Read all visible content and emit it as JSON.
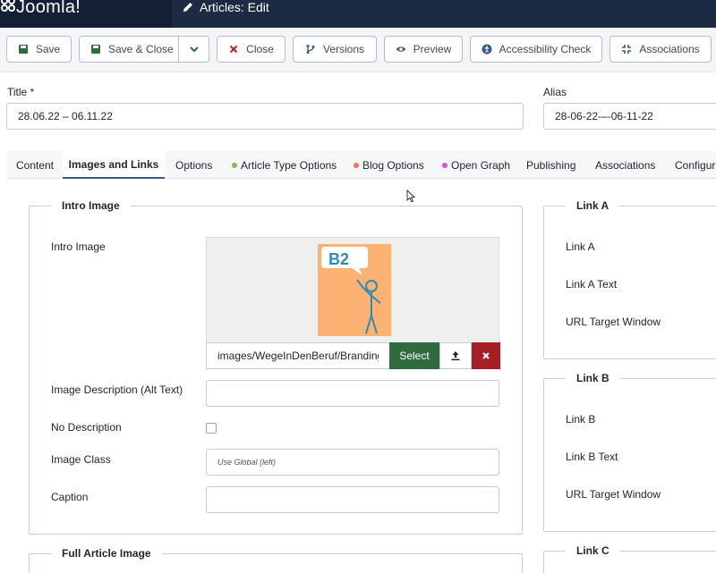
{
  "header": {
    "brand": "Joomla!",
    "page_title": "Articles: Edit"
  },
  "toolbar": {
    "save": "Save",
    "save_close": "Save & Close",
    "close": "Close",
    "versions": "Versions",
    "preview": "Preview",
    "accessibility": "Accessibility Check",
    "associations": "Associations"
  },
  "form": {
    "title_label": "Title *",
    "title_value": "28.06.22 – 06.11.22",
    "alias_label": "Alias",
    "alias_value": "28-06-22-–-06-11-22"
  },
  "tabs": [
    {
      "label": "Content"
    },
    {
      "label": "Images and Links"
    },
    {
      "label": "Options"
    },
    {
      "label": "Article Type Options"
    },
    {
      "label": "Blog Options"
    },
    {
      "label": "Open Graph"
    },
    {
      "label": "Publishing"
    },
    {
      "label": "Associations"
    },
    {
      "label": "Configure"
    }
  ],
  "intro": {
    "legend": "Intro Image",
    "image_label": "Intro Image",
    "badge_text": "B2",
    "path": "images/WegeInDenBeruf/Branding/",
    "select_label": "Select",
    "alt_label": "Image Description (Alt Text)",
    "alt_value": "",
    "no_desc_label": "No Description",
    "class_label": "Image Class",
    "class_placeholder": "Use Global (left)",
    "caption_label": "Caption",
    "caption_value": ""
  },
  "full": {
    "legend": "Full Article Image"
  },
  "link_a": {
    "legend": "Link A",
    "url": "Link A",
    "text": "Link A Text",
    "target": "URL Target Window"
  },
  "link_b": {
    "legend": "Link B",
    "url": "Link B",
    "text": "Link B Text",
    "target": "URL Target Window"
  },
  "link_c": {
    "legend": "Link C"
  },
  "colors": {
    "header": "#1c2a44",
    "select_button": "#2f6b3f",
    "clear_button": "#a51f24",
    "image_background": "#fbb272",
    "badge": "#2f8cb0"
  }
}
